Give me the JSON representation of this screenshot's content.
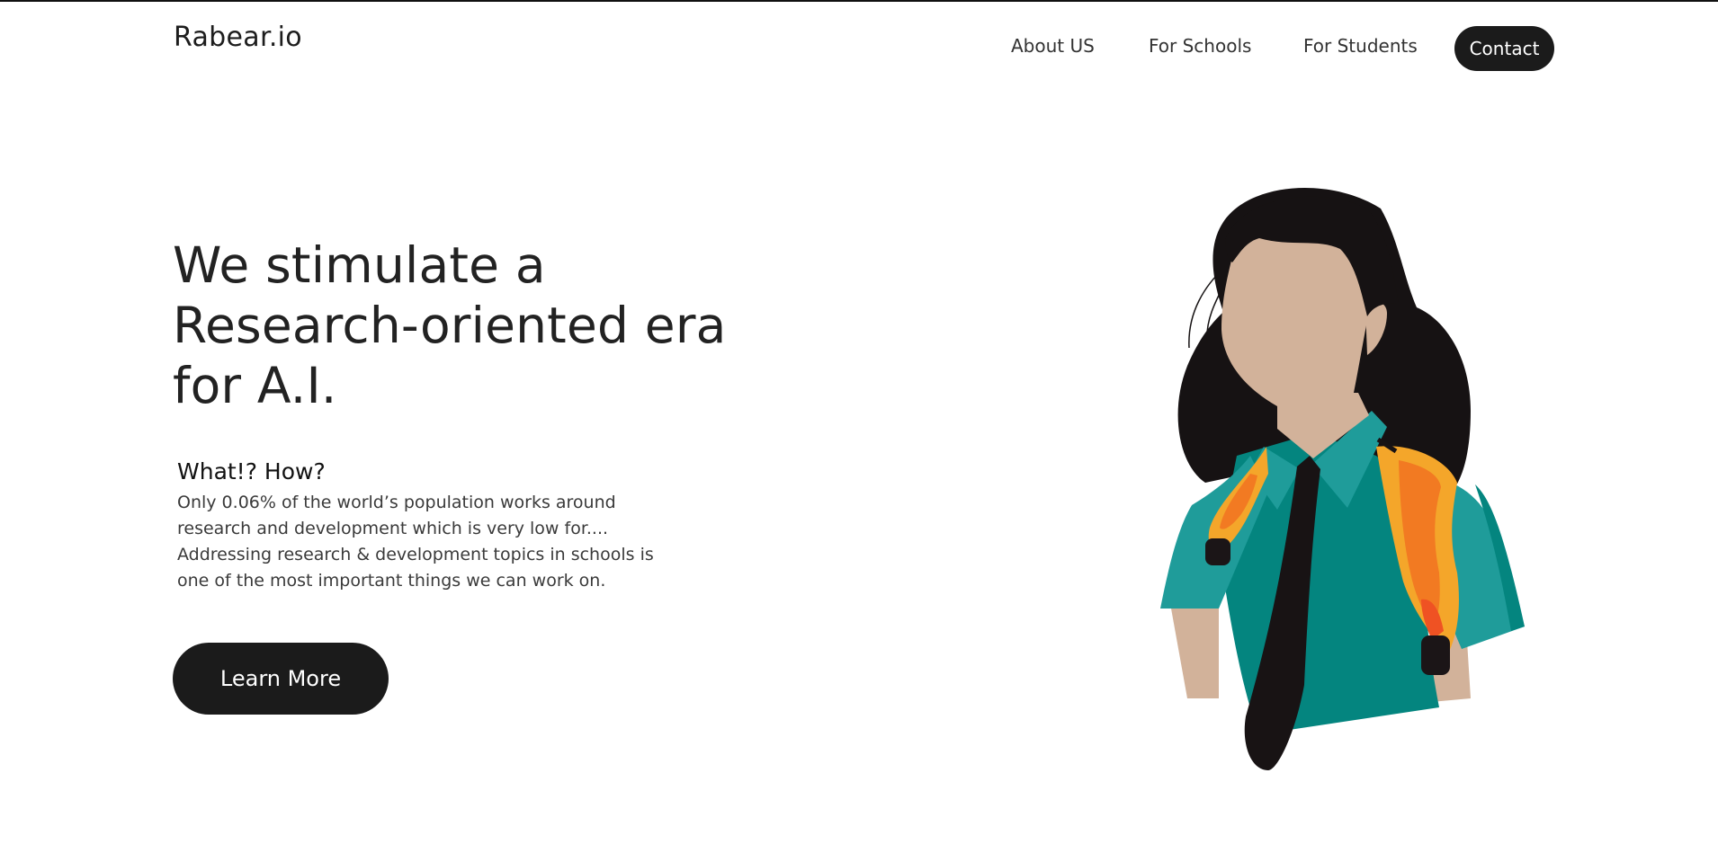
{
  "header": {
    "logo": "Rabear.io",
    "nav": {
      "about": "About US",
      "schools": "For Schools",
      "students": "For Students",
      "contact": "Contact"
    }
  },
  "hero": {
    "title_lines": [
      "We stimulate a",
      "Research-oriented era",
      "for A.I."
    ],
    "subheading": "What!? How?",
    "description_lines": [
      "Only 0.06% of the world’s population works around",
      "research and development which is very low for....",
      "Addressing research & development topics in schools is",
      "one of the most important things we can work on."
    ],
    "cta": "Learn More"
  },
  "illustration": {
    "icon": "student-with-backpack-illustration",
    "colors": {
      "hair": "#161213",
      "skin": "#d2b29a",
      "shirt": "#1f9c9a",
      "shirt_dark": "#04857f",
      "tie": "#181314",
      "backpack": "#f4a62a",
      "backpack_inner": "#f27a22",
      "backpack_accent": "#ef5223"
    }
  },
  "colors": {
    "button_bg": "#1b1b1b",
    "button_text": "#ffffff",
    "text": "#222222"
  }
}
